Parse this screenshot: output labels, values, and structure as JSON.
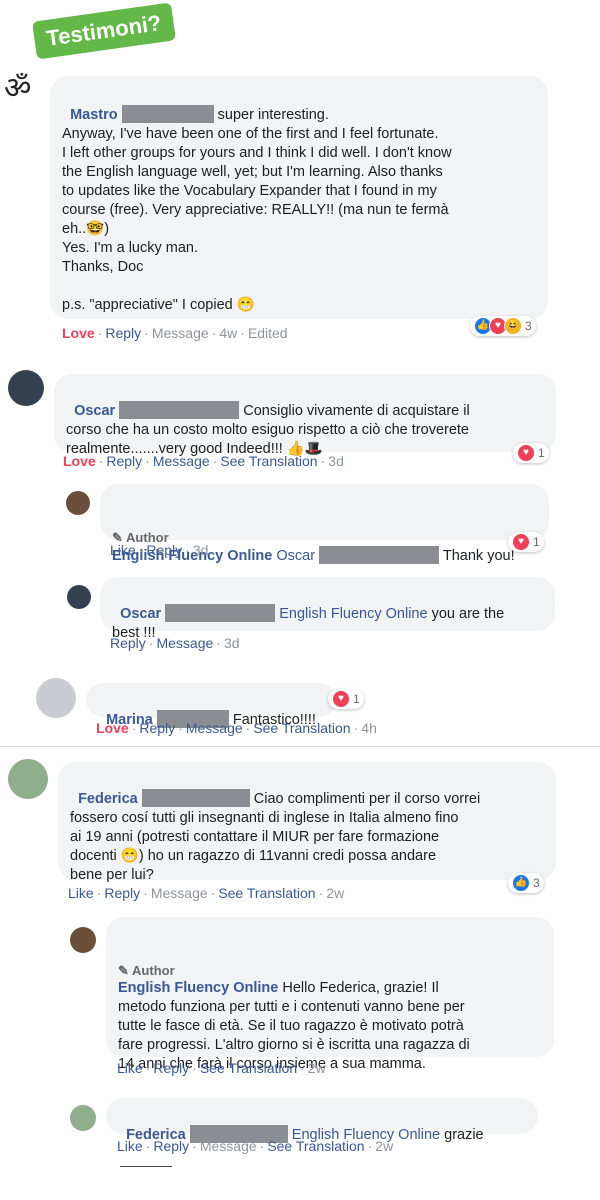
{
  "tag": "Testimoni?",
  "c1": {
    "name": "Mastro",
    "l1": "super interesting.",
    "body": "Anyway, I've have been one of the first and I feel fortunate.\nI left other groups for yours and I think I did well. I don't know\nthe English language well, yet; but I'm learning. Also thanks\nto updates like the Vocabulary Expander that I found in my\ncourse (free). Very appreciative: REALLY!! (ma nun te fermà\neh..🤓)\nYes. I'm a lucky man.\nThanks, Doc\n\np.s. \"appreciative\" I copied 😁",
    "love": "Love",
    "reply": "Reply",
    "message": "Message",
    "time": "4w",
    "edited": "Edited",
    "count": "3"
  },
  "c2": {
    "name": "Oscar",
    "body": "Consiglio vivamente di acquistare il\ncorso che ha un costo molto esiguo rispetto a ciò che troverete\nrealmente.......very good Indeed!!! 👍🎩",
    "love": "Love",
    "reply": "Reply",
    "message": "Message",
    "translation": "See Translation",
    "time": "3d",
    "count": "1"
  },
  "r1": {
    "author": "Author",
    "name": "English Fluency Online",
    "mention": "Oscar",
    "body": "Thank you!",
    "like": "Like",
    "reply": "Reply",
    "time": "3d",
    "count": "1"
  },
  "r2": {
    "name": "Oscar",
    "mention": "English Fluency Online",
    "l1": "you are the",
    "l2": "best !!!",
    "reply": "Reply",
    "message": "Message",
    "time": "3d"
  },
  "c3": {
    "name": "Marina",
    "body": "Fantastico!!!!",
    "love": "Love",
    "reply": "Reply",
    "message": "Message",
    "translation": "See Translation",
    "time": "4h",
    "count": "1"
  },
  "c4": {
    "name": "Federica",
    "l1": "Ciao complimenti per il corso vorrei",
    "body": "fossero cosí tutti gli insegnanti di inglese in Italia almeno fino\nai 19 anni (potresti contattare il MIUR per fare formazione\ndocenti 😁) ho un ragazzo di 11vanni credi possa andare\nbene per lui?",
    "like": "Like",
    "reply": "Reply",
    "message": "Message",
    "translation": "See Translation",
    "time": "2w",
    "count": "3"
  },
  "r3": {
    "author": "Author",
    "name": "English Fluency Online",
    "l1": "Hello Federica, grazie! Il",
    "body": "metodo funziona per tutti e i contenuti vanno bene per\ntutte le fasce di età. Se il tuo ragazzo è motivato potrà\nfare progressi. L'altro giorno si è iscritta una ragazza di\n14 anni che farà il corso insieme a sua mamma.",
    "like": "Like",
    "reply": "Reply",
    "translation": "See Translation",
    "time": "2w"
  },
  "r4": {
    "name": "Federica",
    "mention": "English Fluency Online",
    "body": "grazie",
    "like": "Like",
    "reply": "Reply",
    "message": "Message",
    "translation": "See Translation",
    "time": "2w"
  }
}
